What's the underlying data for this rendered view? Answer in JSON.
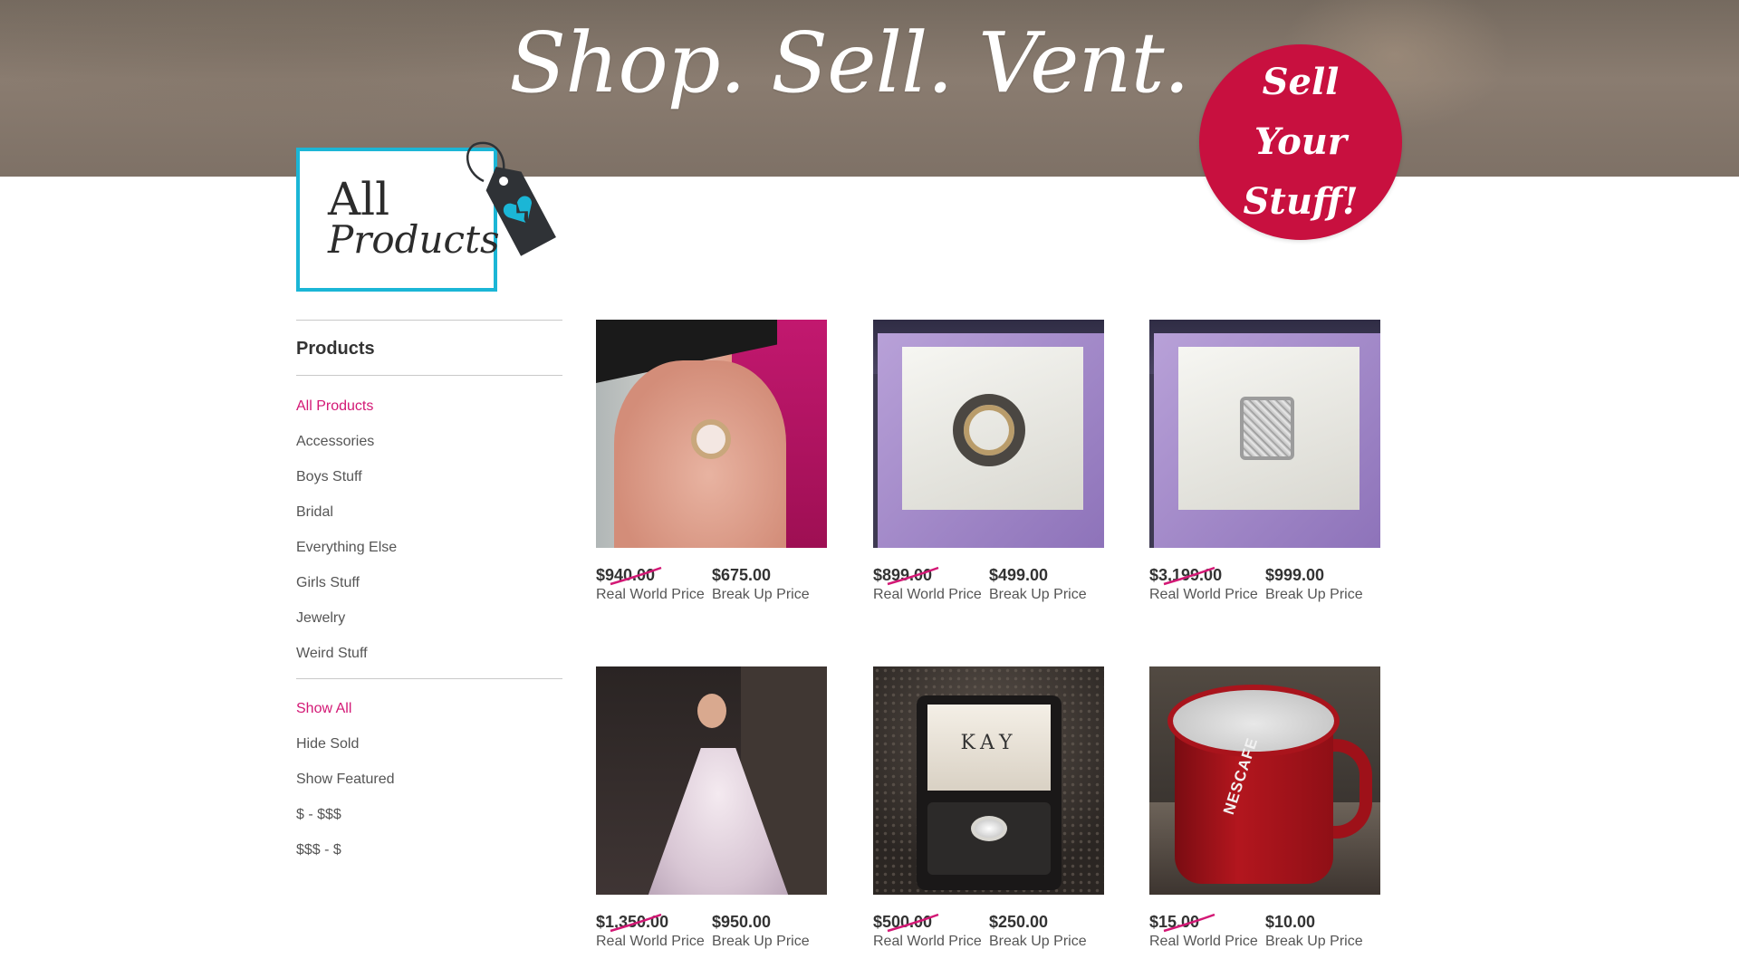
{
  "hero": {
    "tagline": "Shop. Sell. Vent.",
    "sell_badge_line1": "Sell Your",
    "sell_badge_line2": "Stuff!"
  },
  "page_heading": {
    "line1": "All",
    "line2": "Products"
  },
  "colors": {
    "accent_pink": "#d31875",
    "badge_red": "#c8103f",
    "heading_box_border": "#1bb6d6",
    "tag_icon": "#2f3236",
    "heart_icon": "#1bb6d6"
  },
  "sidebar": {
    "heading": "Products",
    "categories": [
      {
        "label": "All Products",
        "active": true
      },
      {
        "label": "Accessories",
        "active": false
      },
      {
        "label": "Boys Stuff",
        "active": false
      },
      {
        "label": "Bridal",
        "active": false
      },
      {
        "label": "Everything Else",
        "active": false
      },
      {
        "label": "Girls Stuff",
        "active": false
      },
      {
        "label": "Jewelry",
        "active": false
      },
      {
        "label": "Weird Stuff",
        "active": false
      }
    ],
    "filters": [
      {
        "label": "Show All",
        "active": true
      },
      {
        "label": "Hide Sold",
        "active": false
      },
      {
        "label": "Show Featured",
        "active": false
      },
      {
        "label": "$ - $$$",
        "active": false
      },
      {
        "label": "$$$ - $",
        "active": false
      }
    ]
  },
  "products": [
    {
      "image": "ring-on-hand",
      "real_price": "$940.00",
      "break_price": "$675.00",
      "real_label": "Real World Price",
      "break_label": "Break Up Price"
    },
    {
      "image": "band-in-purple-box",
      "real_price": "$899.00",
      "break_price": "$499.00",
      "real_label": "Real World Price",
      "break_label": "Break Up Price"
    },
    {
      "image": "diamond-ring-in-box",
      "real_price": "$3,199.00",
      "break_price": "$999.00",
      "real_label": "Real World Price",
      "break_label": "Break Up Price"
    },
    {
      "image": "wedding-dress",
      "real_price": "$1,350.00",
      "break_price": "$950.00",
      "real_label": "Real World Price",
      "break_label": "Break Up Price"
    },
    {
      "image": "kay-ring-box",
      "real_price": "$500.00",
      "break_price": "$250.00",
      "real_label": "Real World Price",
      "break_label": "Break Up Price"
    },
    {
      "image": "nescafe-mug",
      "real_price": "$15.00",
      "break_price": "$10.00",
      "real_label": "Real World Price",
      "break_label": "Break Up Price"
    }
  ],
  "image_text": {
    "kay_logo": "KAY",
    "mug_brand": "NESCAFE"
  }
}
